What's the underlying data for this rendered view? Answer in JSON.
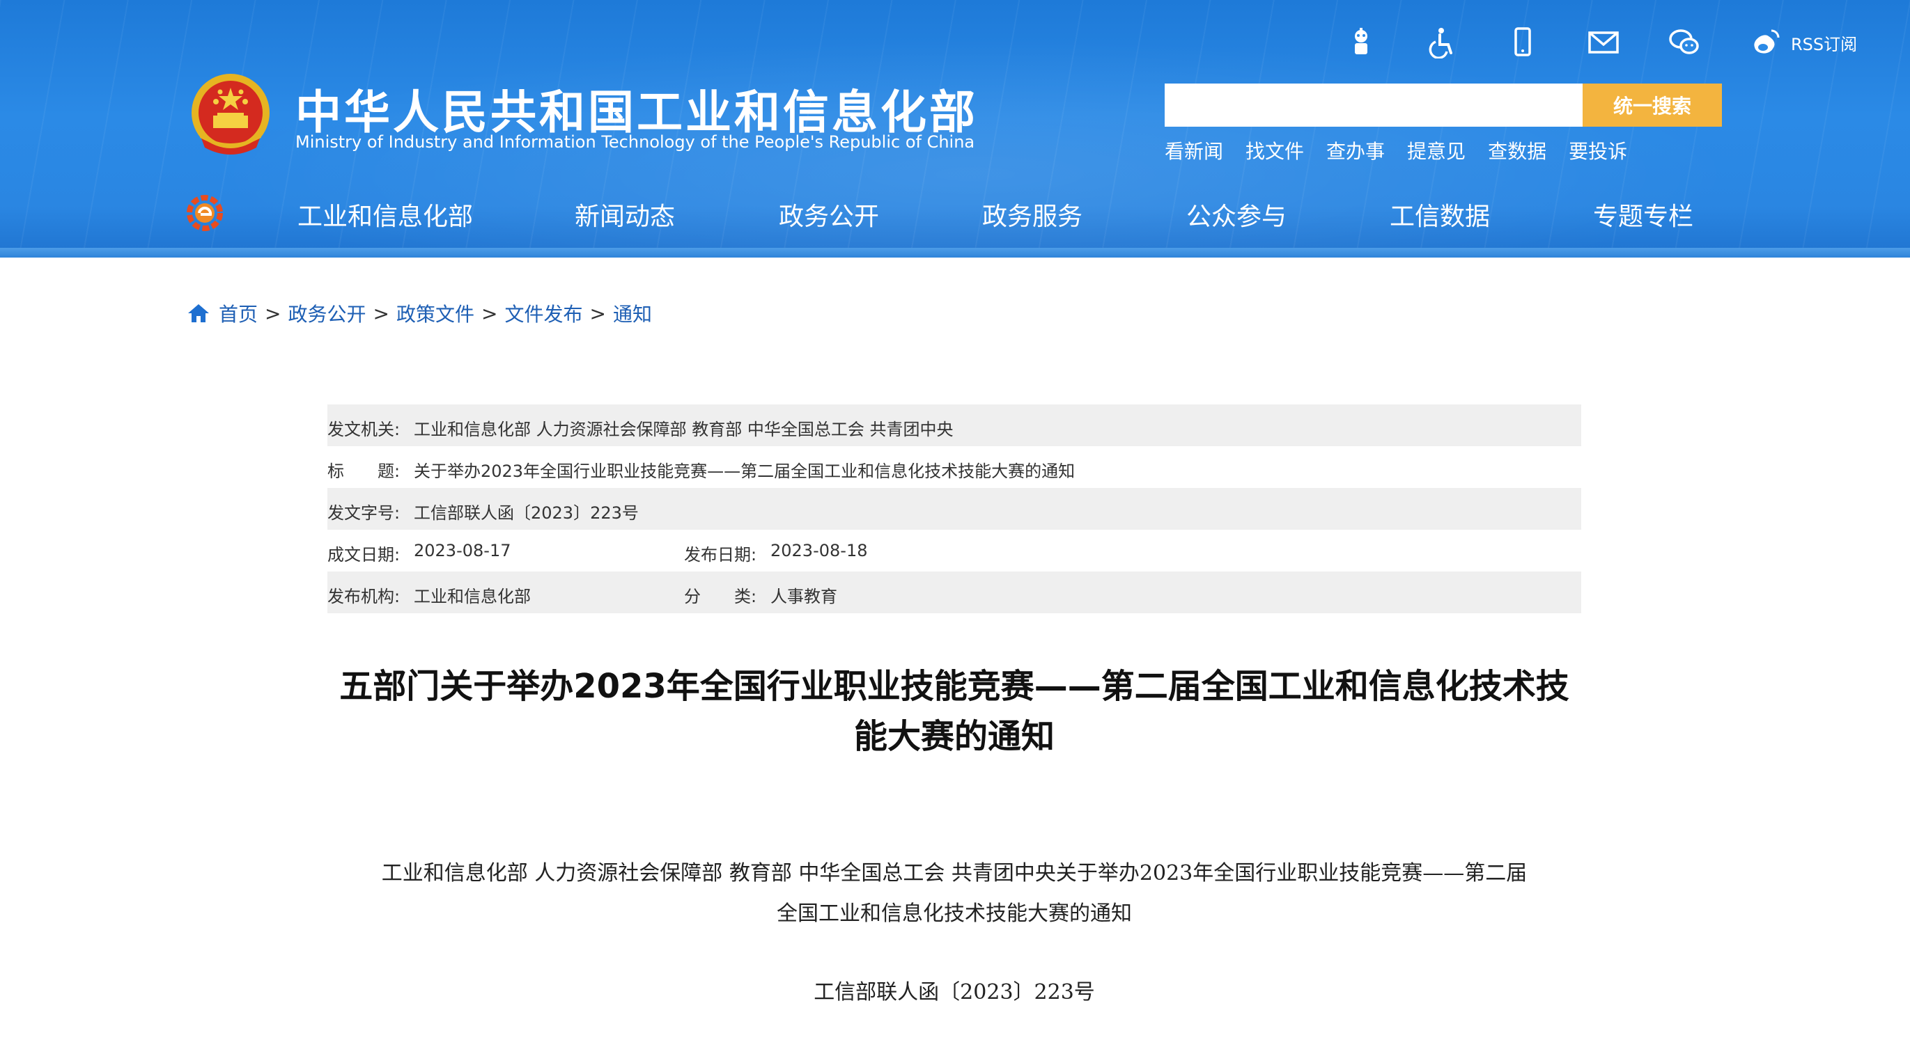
{
  "header": {
    "title_cn": "中华人民共和国工业和信息化部",
    "title_en": "Ministry of Industry and Information Technology of the People's Republic of China",
    "top_icons": [
      "robot-icon",
      "accessibility-icon",
      "mobile-icon",
      "mail-icon",
      "wechat-icon",
      "weibo-icon"
    ],
    "rss_label": "RSS订阅",
    "search_placeholder": "",
    "search_button": "统一搜索",
    "quick_links": [
      "看新闻",
      "找文件",
      "查办事",
      "提意见",
      "查数据",
      "要投诉"
    ],
    "nav": [
      "工业和信息化部",
      "新闻动态",
      "政务公开",
      "政务服务",
      "公众参与",
      "工信数据",
      "专题专栏"
    ],
    "colors": {
      "header_blue": "#2b8ae6",
      "search_button": "#f3b43f",
      "link_blue": "#1e5fb4"
    }
  },
  "breadcrumb": [
    "首页",
    "政务公开",
    "政策文件",
    "文件发布",
    "通知"
  ],
  "breadcrumb_sep": ">",
  "meta": {
    "issuer_label": "发文机关:",
    "issuer": "工业和信息化部 人力资源社会保障部 教育部 中华全国总工会 共青团中央",
    "title_label": "标　　题:",
    "title": "关于举办2023年全国行业职业技能竞赛——第二届全国工业和信息化技术技能大赛的通知",
    "docno_label": "发文字号:",
    "docno": "工信部联人函〔2023〕223号",
    "written_label": "成文日期:",
    "written": "2023-08-17",
    "published_label": "发布日期:",
    "published": "2023-08-18",
    "org_label": "发布机构:",
    "org": "工业和信息化部",
    "category_label": "分　　类:",
    "category": "人事教育"
  },
  "article": {
    "title_line1": "五部门关于举办2023年全国行业职业技能竞赛——第二届全国工业和信息化技术技",
    "title_line2": "能大赛的通知",
    "subtitle_line1": "工业和信息化部 人力资源社会保障部 教育部 中华全国总工会 共青团中央关于举办2023年全国行业职业技能竞赛——第二届",
    "subtitle_line2": "全国工业和信息化技术技能大赛的通知",
    "doc_no": "工信部联人函〔2023〕223号"
  }
}
